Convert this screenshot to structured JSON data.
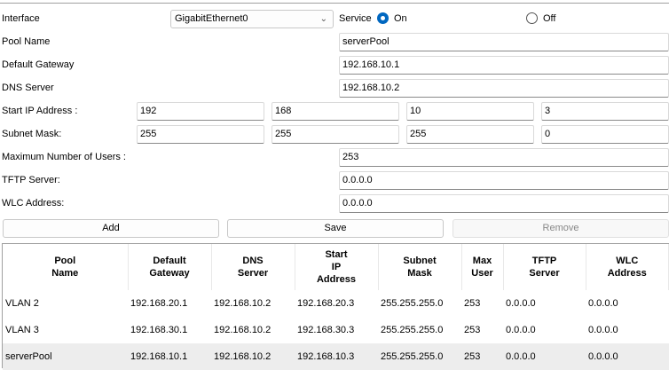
{
  "form": {
    "interface_label": "Interface",
    "interface_value": "GigabitEthernet0",
    "service_label": "Service",
    "service_on": "On",
    "service_off": "Off",
    "service_selected": "On",
    "pool_name_label": "Pool Name",
    "pool_name": "serverPool",
    "gateway_label": "Default Gateway",
    "gateway": "192.168.10.1",
    "dns_label": "DNS Server",
    "dns": "192.168.10.2",
    "start_ip_label": "Start IP Address :",
    "start_ip": [
      "192",
      "168",
      "10",
      "3"
    ],
    "mask_label": "Subnet Mask:",
    "mask": [
      "255",
      "255",
      "255",
      "0"
    ],
    "max_users_label": "Maximum Number of Users :",
    "max_users": "253",
    "tftp_label": "TFTP Server:",
    "tftp": "0.0.0.0",
    "wlc_label": "WLC Address:",
    "wlc": "0.0.0.0"
  },
  "buttons": {
    "add": "Add",
    "save": "Save",
    "remove": "Remove"
  },
  "table": {
    "headers": [
      [
        "Pool",
        "Name"
      ],
      [
        "Default",
        "Gateway"
      ],
      [
        "DNS",
        "Server"
      ],
      [
        "Start",
        "IP",
        "Address"
      ],
      [
        "Subnet",
        "Mask"
      ],
      [
        "Max",
        "User"
      ],
      [
        "TFTP",
        "Server"
      ],
      [
        "WLC",
        "Address"
      ]
    ],
    "rows": [
      [
        "VLAN 2",
        "192.168.20.1",
        "192.168.10.2",
        "192.168.20.3",
        "255.255.255.0",
        "253",
        "0.0.0.0",
        "0.0.0.0"
      ],
      [
        "VLAN 3",
        "192.168.30.1",
        "192.168.10.2",
        "192.168.30.3",
        "255.255.255.0",
        "253",
        "0.0.0.0",
        "0.0.0.0"
      ],
      [
        "serverPool",
        "192.168.10.1",
        "192.168.10.2",
        "192.168.10.3",
        "255.255.255.0",
        "253",
        "0.0.0.0",
        "0.0.0.0"
      ]
    ],
    "selected_row": 2
  }
}
